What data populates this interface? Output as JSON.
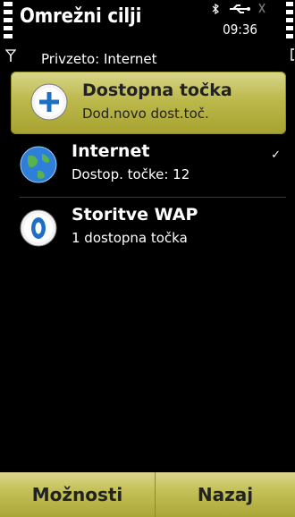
{
  "status": {
    "title": "Omrežni cilji",
    "time": "09:36",
    "subtitle": "Privzeto: Internet",
    "icons": [
      "signal-strength-icon",
      "bluetooth-icon",
      "usb-icon",
      "battery-icon",
      "antenna-icon"
    ]
  },
  "list": {
    "items": [
      {
        "icon": "add-plus-icon",
        "line1": "Dostopna točka",
        "line2": "Dod.novo dost.toč.",
        "selected": true
      },
      {
        "icon": "globe-icon",
        "line1": "Internet",
        "line2": "Dostop. točke: 12",
        "check": "✓"
      },
      {
        "icon": "wap-zero-icon",
        "line1": "Storitve WAP",
        "line2": "1 dostopna točka"
      }
    ]
  },
  "softkeys": {
    "left": "Možnosti",
    "right": "Nazaj"
  },
  "colors": {
    "accent": "#bcb94c",
    "background": "#000000",
    "text": "#ffffff"
  }
}
